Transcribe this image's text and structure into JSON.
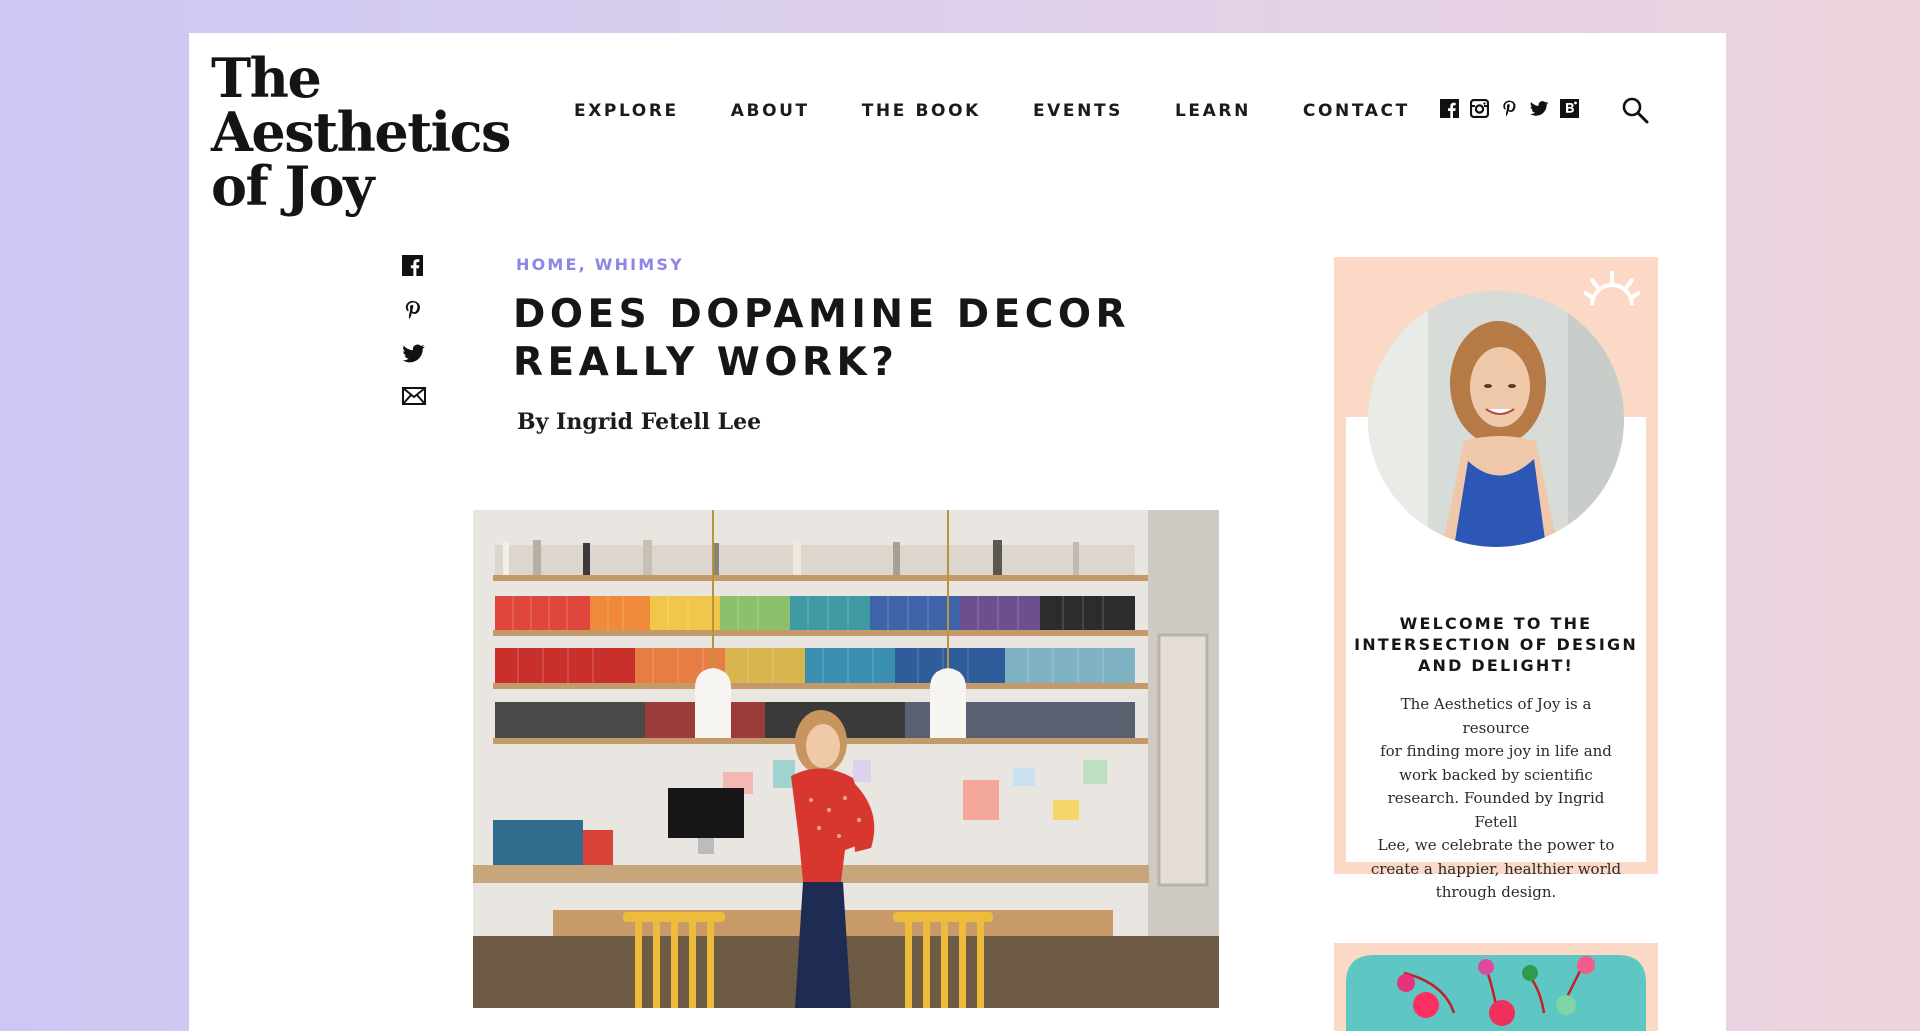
{
  "site": {
    "logo_lines": [
      "The",
      "Aesthetics",
      "of Joy"
    ]
  },
  "nav": {
    "items": [
      "EXPLORE",
      "ABOUT",
      "THE BOOK",
      "EVENTS",
      "LEARN",
      "CONTACT"
    ]
  },
  "social_icons": [
    "facebook-icon",
    "instagram-icon",
    "pinterest-icon",
    "twitter-icon",
    "bloglovin-icon"
  ],
  "share_icons": [
    "facebook-icon",
    "pinterest-icon",
    "twitter-icon",
    "email-icon"
  ],
  "article": {
    "category_1": "HOME",
    "category_sep": ", ",
    "category_2": "WHIMSY",
    "title_line_1": "DOES DOPAMINE DECOR",
    "title_line_2": "REALLY WORK?",
    "byline": "By Ingrid Fetell Lee"
  },
  "sidebar": {
    "welcome_lines": [
      "WELCOME TO THE",
      "INTERSECTION OF DESIGN",
      "AND DELIGHT!"
    ],
    "about_lines": [
      "The Aesthetics of Joy is a resource",
      "for finding more joy in life and",
      "work backed by scientific",
      "research. Founded by Ingrid Fetell",
      "Lee, we celebrate the power to",
      "create a happier, healthier world",
      "through design."
    ]
  },
  "colors": {
    "accent_category": "#8d86e6",
    "sidebar_peach": "#fcd8c6",
    "text_dark": "#161616"
  }
}
